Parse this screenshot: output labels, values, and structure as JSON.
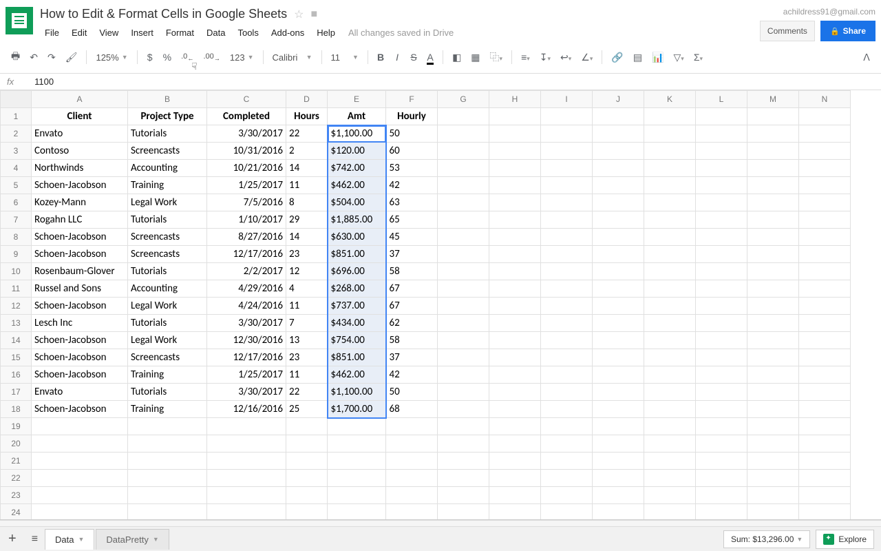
{
  "header": {
    "doc_title": "How to Edit & Format Cells in Google Sheets",
    "user_email": "achildress91@gmail.com",
    "comments_label": "Comments",
    "share_label": "Share",
    "save_status": "All changes saved in Drive",
    "menus": [
      "File",
      "Edit",
      "View",
      "Insert",
      "Format",
      "Data",
      "Tools",
      "Add-ons",
      "Help"
    ]
  },
  "toolbar": {
    "zoom": "125%",
    "font": "Calibri",
    "font_size": "11",
    "currency": "$",
    "percent": "%",
    "dec_less": ".0",
    "dec_more": ".00",
    "num_format": "123"
  },
  "formula_bar": {
    "fx": "fx",
    "value": "1100"
  },
  "columns": [
    "A",
    "B",
    "C",
    "D",
    "E",
    "F",
    "G",
    "H",
    "I",
    "J",
    "K",
    "L",
    "M",
    "N"
  ],
  "row_count": 24,
  "sheet": {
    "headers": [
      "Client",
      "Project Type",
      "Completed",
      "Hours",
      "Amt",
      "Hourly"
    ],
    "rows": [
      {
        "client": "Envato",
        "type": "Tutorials",
        "date": "3/30/2017",
        "hours": "22",
        "amt": "$1,100.00",
        "hourly": "50"
      },
      {
        "client": "Contoso",
        "type": "Screencasts",
        "date": "10/31/2016",
        "hours": "2",
        "amt": "$120.00",
        "hourly": "60"
      },
      {
        "client": "Northwinds",
        "type": "Accounting",
        "date": "10/21/2016",
        "hours": "14",
        "amt": "$742.00",
        "hourly": "53"
      },
      {
        "client": "Schoen-Jacobson",
        "type": "Training",
        "date": "1/25/2017",
        "hours": "11",
        "amt": "$462.00",
        "hourly": "42"
      },
      {
        "client": "Kozey-Mann",
        "type": "Legal Work",
        "date": "7/5/2016",
        "hours": "8",
        "amt": "$504.00",
        "hourly": "63"
      },
      {
        "client": "Rogahn LLC",
        "type": "Tutorials",
        "date": "1/10/2017",
        "hours": "29",
        "amt": "$1,885.00",
        "hourly": "65"
      },
      {
        "client": "Schoen-Jacobson",
        "type": "Screencasts",
        "date": "8/27/2016",
        "hours": "14",
        "amt": "$630.00",
        "hourly": "45"
      },
      {
        "client": "Schoen-Jacobson",
        "type": "Screencasts",
        "date": "12/17/2016",
        "hours": "23",
        "amt": "$851.00",
        "hourly": "37"
      },
      {
        "client": "Rosenbaum-Glover",
        "type": "Tutorials",
        "date": "2/2/2017",
        "hours": "12",
        "amt": "$696.00",
        "hourly": "58"
      },
      {
        "client": "Russel and Sons",
        "type": "Accounting",
        "date": "4/29/2016",
        "hours": "4",
        "amt": "$268.00",
        "hourly": "67"
      },
      {
        "client": "Schoen-Jacobson",
        "type": "Legal Work",
        "date": "4/24/2016",
        "hours": "11",
        "amt": "$737.00",
        "hourly": "67"
      },
      {
        "client": "Lesch Inc",
        "type": "Tutorials",
        "date": "3/30/2017",
        "hours": "7",
        "amt": "$434.00",
        "hourly": "62"
      },
      {
        "client": "Schoen-Jacobson",
        "type": "Legal Work",
        "date": "12/30/2016",
        "hours": "13",
        "amt": "$754.00",
        "hourly": "58"
      },
      {
        "client": "Schoen-Jacobson",
        "type": "Screencasts",
        "date": "12/17/2016",
        "hours": "23",
        "amt": "$851.00",
        "hourly": "37"
      },
      {
        "client": "Schoen-Jacobson",
        "type": "Training",
        "date": "1/25/2017",
        "hours": "11",
        "amt": "$462.00",
        "hourly": "42"
      },
      {
        "client": "Envato",
        "type": "Tutorials",
        "date": "3/30/2017",
        "hours": "22",
        "amt": "$1,100.00",
        "hourly": "50"
      },
      {
        "client": "Schoen-Jacobson",
        "type": "Training",
        "date": "12/16/2016",
        "hours": "25",
        "amt": "$1,700.00",
        "hourly": "68"
      }
    ]
  },
  "footer": {
    "tabs": [
      "Data",
      "DataPretty"
    ],
    "sum": "Sum: $13,296.00",
    "explore_label": "Explore"
  }
}
